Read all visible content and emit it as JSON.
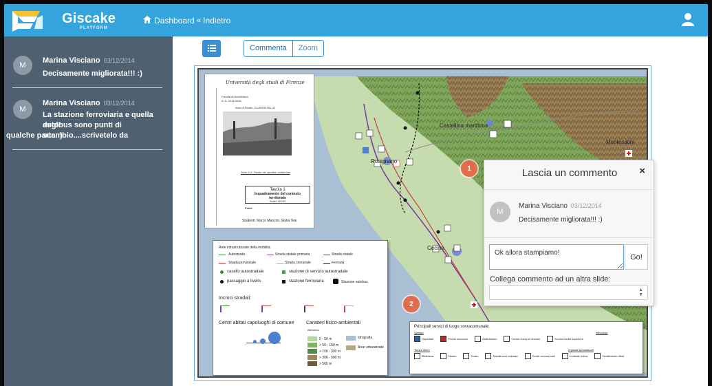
{
  "header": {
    "brand": "Giscake",
    "brand_sub": "PLATFORM",
    "nav_dashboard": "Dashboard",
    "nav_back": "Indietro",
    "color": "#35a4dc"
  },
  "sidebar": {
    "comments": [
      {
        "avatar": "M",
        "author": "Marina Visciano",
        "date": "03/12/2014",
        "text": "Decisamente migliorata!!! :)"
      },
      {
        "avatar": "M",
        "author": "Marina Visciano",
        "date": "03/12/2014",
        "text_lines": [
          "La stazione ferroviaria e quella degli",
          "autobus sono punti di scambio....scrivetelo da",
          "qualche parte :)"
        ]
      }
    ]
  },
  "toolbar": {
    "list_icon": "list-icon",
    "view_comment": "Commenta",
    "view_zoom": "Zoom"
  },
  "slide": {
    "university": "Università degli studi di Firenze",
    "faculty": "Facoltà di Architettura",
    "year": "A. A. 2014/2015",
    "area": "Area di Studio: GUARDISTALLO",
    "series": "Serie A.A. Studio dei caratteri ambientali",
    "table_title": "Tavola 1",
    "table_subtitle": "Inquadramento del contesto territoriale",
    "scale": "Scala 1:50.000",
    "source_label": "Fonti:",
    "students": "Studenti: Marco Mancini, Giulia Tesi",
    "places": [
      "Castellina marittima",
      "Rosignano",
      "Cecina",
      "Montecatini"
    ],
    "markers": [
      "1",
      "2"
    ],
    "legend": {
      "title": "Rete infrastrutturale della mobilità",
      "roads": [
        "Autostrada",
        "Strada statale primaria",
        "Strada statale",
        "Strada provinciale",
        "Strada comunale",
        "Ferrovia"
      ],
      "points": [
        "casello autostradale",
        "stazione di servizio autostradale",
        "passaggio a livello",
        "stazione ferroviaria",
        "Stazione autobus"
      ],
      "crossings_title": "Incroci stradali:",
      "centers_title": "Centri abitati capoluoghi di comune",
      "physical_title": "Caratteri fisico-ambientali",
      "altimetry": "Altimetria",
      "bands": [
        "0 - 50 m",
        "> 50 - 150 m",
        "> 150 - 300 m",
        "> 300 - 500 m",
        "> 500 m"
      ],
      "band_colors": [
        "#b4d69a",
        "#7fb36a",
        "#4f8a48",
        "#9c8a5a",
        "#6f5a3a"
      ],
      "hydro": "Idrografia",
      "urban": "Aree urbanizzate"
    },
    "services": {
      "title": "Principali servizi di luogo sovracomunale:",
      "groups": [
        "Sanitari",
        "Istruzione",
        "Tempo libero",
        "Impianti specializzati"
      ],
      "items": [
        "Ospedale",
        "Pronto soccorso",
        "Ambulatorio",
        "Centro cura per anziani",
        "Scuola media superiore",
        "Biblioteca",
        "Museo",
        "Teatro",
        "Stabilimenti balneari",
        "Centri commerciali",
        "Centrale eolica",
        "Smaltimento rifiuti"
      ]
    }
  },
  "popup": {
    "title": "Lascia un commento",
    "close": "×",
    "avatar": "M",
    "author": "Marina Visciano",
    "date": "03/12/2014",
    "text": "Decisamente migliorata!!! :)",
    "input_value": "Ok allora stampiamo!",
    "go": "Go!",
    "link_label": "Collega commento ad un altra slide:",
    "select_value": ""
  }
}
